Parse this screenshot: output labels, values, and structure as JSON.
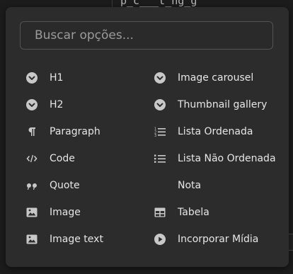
{
  "background": {
    "code_fragment": "p_c___t_ng_g"
  },
  "menu": {
    "search": {
      "placeholder": "Buscar opções...",
      "value": ""
    },
    "left_items": [
      {
        "label": "H1",
        "icon": "chevron-circle-icon"
      },
      {
        "label": "H2",
        "icon": "chevron-circle-icon"
      },
      {
        "label": "Paragraph",
        "icon": "pilcrow-icon"
      },
      {
        "label": "Code",
        "icon": "code-icon"
      },
      {
        "label": "Quote",
        "icon": "quote-icon"
      },
      {
        "label": "Image",
        "icon": "image-icon"
      },
      {
        "label": "Image text",
        "icon": "image-icon"
      }
    ],
    "right_items": [
      {
        "label": "Image carousel",
        "icon": "chevron-circle-icon"
      },
      {
        "label": "Thumbnail gallery",
        "icon": "chevron-circle-icon"
      },
      {
        "label": "Lista Ordenada",
        "icon": "ordered-list-icon"
      },
      {
        "label": "Lista Não Ordenada",
        "icon": "unordered-list-icon"
      },
      {
        "label": "Nota",
        "icon": "none"
      },
      {
        "label": "Tabela",
        "icon": "table-icon"
      },
      {
        "label": "Incorporar Mídia",
        "icon": "play-circle-icon"
      }
    ]
  },
  "colors": {
    "panel": "#2c2c2c",
    "text": "#e6e6e6",
    "icon": "#c8c8c8",
    "placeholder": "#9b9b9b"
  }
}
